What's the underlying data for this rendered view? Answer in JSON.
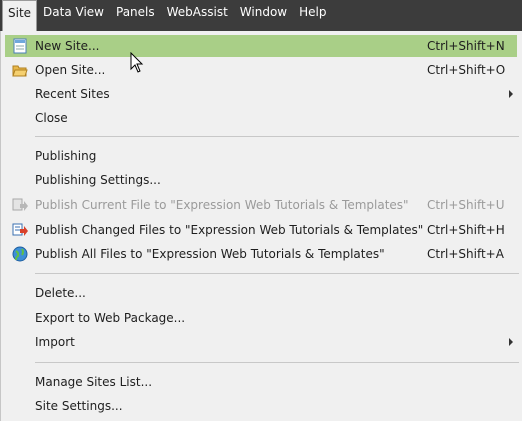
{
  "menubar": {
    "items": [
      "Site",
      "Data View",
      "Panels",
      "WebAssist",
      "Window",
      "Help"
    ]
  },
  "menu": {
    "new_site": {
      "label": "New Site...",
      "shortcut": "Ctrl+Shift+N"
    },
    "open_site": {
      "label": "Open Site...",
      "shortcut": "Ctrl+Shift+O"
    },
    "recent_sites": {
      "label": "Recent Sites"
    },
    "close": {
      "label": "Close"
    },
    "publishing": {
      "label": "Publishing"
    },
    "publishing_settings": {
      "label": "Publishing Settings..."
    },
    "publish_current": {
      "label": "Publish Current File to \"Expression Web Tutorials & Templates\"",
      "shortcut": "Ctrl+Shift+U"
    },
    "publish_changed": {
      "label": "Publish Changed Files to \"Expression Web Tutorials & Templates\"",
      "shortcut": "Ctrl+Shift+H"
    },
    "publish_all": {
      "label": "Publish All Files to \"Expression Web Tutorials & Templates\"",
      "shortcut": "Ctrl+Shift+A"
    },
    "delete": {
      "label": "Delete..."
    },
    "export": {
      "label": "Export to Web Package..."
    },
    "import": {
      "label": "Import"
    },
    "manage_sites": {
      "label": "Manage Sites List..."
    },
    "site_settings": {
      "label": "Site Settings..."
    }
  },
  "colors": {
    "menubar_bg": "#3c3c3c",
    "menu_bg": "#f0f0f0",
    "highlight": "#a9cf87",
    "disabled_text": "#9a9a9a"
  }
}
